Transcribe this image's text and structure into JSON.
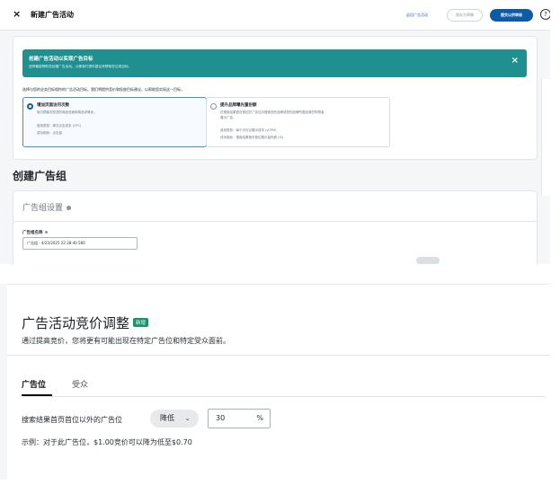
{
  "topbar": {
    "close_icon": "×",
    "title": "新建广告活动",
    "link_label": "返回广告活动",
    "draft_label": "保存为草稿",
    "submit_label": "提交以供审核",
    "help_icon": "?"
  },
  "goal": {
    "banner_title": "创建广告活动以实现广告目标",
    "banner_desc": "选择最能帮助您创建广告活动，以便我们提供建议来帮助您达成目标。",
    "close_icon": "×",
    "prompt": "选择与您的业务目标相符的广告活动目标。我们将提供竞价和投放目标建议，以帮助您实现这一目标。",
    "options": [
      {
        "title": "增加页面访问次数",
        "line1": "吸引顾客浏览您的商品页面和商品详情页。",
        "line2": "费用类型：单次点击成本 (CPC)",
        "line3": "成功指标：点击量"
      },
      {
        "title": "提升品牌曝光量份额",
        "line1": "在搜索结果首页首位的广告位向搜索您的品牌或您的品牌所属品类的购物者",
        "line2": "展示广告。",
        "line3": "费用类型：每千次可见展示成本 (vCPM)",
        "line4": "成功指标：搜索结果首页首位展示量份额 (IS)"
      }
    ]
  },
  "adgroup": {
    "heading": "创建广告组",
    "settings_header": "广告组设置",
    "name_label": "广告组名称",
    "name_value": "广告组 - 4/23/2025 22:28:40.580"
  },
  "bid_adjust": {
    "title": "广告活动竞价调整",
    "badge": "新增",
    "subtitle": "通过提高竞价，您将更有可能出现在特定广告位和特定受众面前。",
    "tabs": [
      "广告位",
      "受众"
    ],
    "placement_label": "搜索结果首页首位以外的广告位",
    "direction_label": "降低",
    "percent_value": "30",
    "percent_sign": "%",
    "example": "示例：对于此广告位，$1.00竞价可以降为低至$0.70"
  },
  "colors": {
    "accent": "#0f5aa5",
    "banner": "#1f8f8f",
    "badge": "#1f8f6d"
  }
}
